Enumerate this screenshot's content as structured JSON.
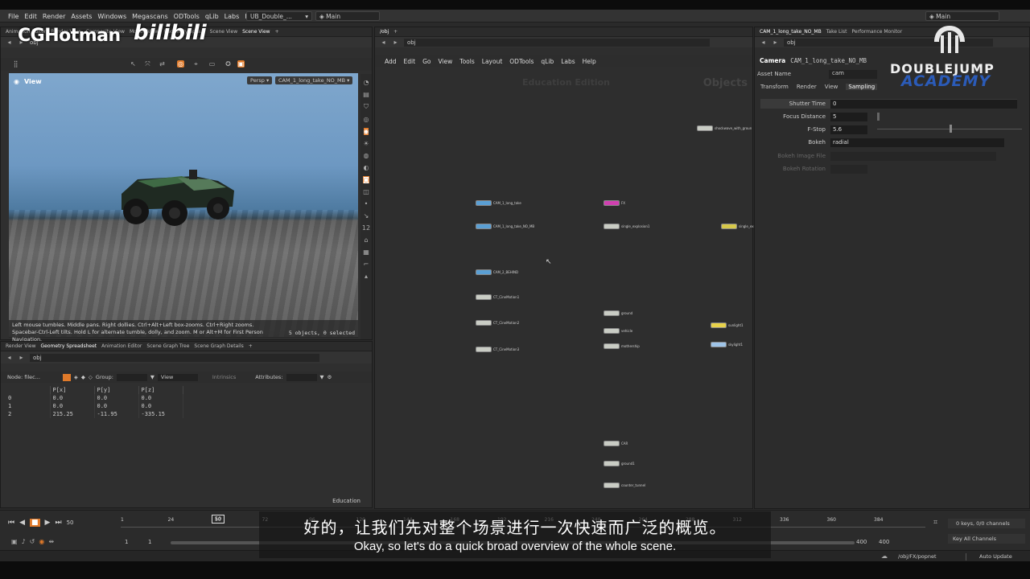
{
  "menubar": {
    "items": [
      "File",
      "Edit",
      "Render",
      "Assets",
      "Windows",
      "Megascans",
      "ODTools",
      "qLib",
      "Labs",
      "Help"
    ],
    "desktop": "UB_Double_...",
    "desktop_right": "Main",
    "desktop_right2": "Main"
  },
  "watermark": {
    "brand": "CGHotman",
    "site": "bilibili",
    "academy_top": "DOUBLEJUMP",
    "academy_bottom": "ACADEMY"
  },
  "left_top": {
    "tabs": [
      "Animation Editor",
      "Render View",
      "Composite View",
      "Motion View",
      "Geometry Spre...",
      "Scene View",
      "Scene View"
    ],
    "path": "obj",
    "viewport_title": "View",
    "persp": "Persp ▾",
    "camera": "CAM_1_long_take_NO_MB ▾",
    "help_text": "Left mouse tumbles. Middle pans. Right dollies. Ctrl+Alt+Left box-zooms. Ctrl+Right zooms. Spacebar-Ctrl-Left tilts. Hold L for alternate tumble, dolly, and zoom. M or Alt+M for First Person Navigation.",
    "selection": "5 objects, 0 selected"
  },
  "left_bottom": {
    "tabs": [
      "Render View",
      "Geometry Spreadsheet",
      "Animation Editor",
      "Scene Graph Tree",
      "Scene Graph Details"
    ],
    "path": "obj",
    "node_label": "Node: filec...",
    "group_label": "Group:",
    "view_label": "View",
    "intrinsics_label": "Intrinsics",
    "attributes_label": "Attributes:",
    "columns": [
      "",
      "P[x]",
      "P[y]",
      "P[z]"
    ],
    "rows": [
      [
        "0",
        "0.0",
        "0.0",
        "0.0"
      ],
      [
        "1",
        "0.0",
        "0.0",
        "0.0"
      ],
      [
        "2",
        "215.25",
        "-11.95",
        "-335.15"
      ]
    ],
    "footer": "Education"
  },
  "network": {
    "tabs": [
      "/obj"
    ],
    "path": "obj",
    "menu": [
      "Add",
      "Edit",
      "Go",
      "View",
      "Tools",
      "Layout",
      "ODTools",
      "qLib",
      "Labs",
      "Help"
    ],
    "watermark": "Education Edition",
    "context": "Objects",
    "nodes": [
      {
        "label": "CAM_1_long_take",
        "color": "#5a9fd4"
      },
      {
        "label": "CAM_1_long_take_NO_MB",
        "color": "#5a9fd4"
      },
      {
        "label": "CAM_2_BEHIND",
        "color": "#5a9fd4"
      },
      {
        "label": "CT_CineMotion1",
        "color": "#c9ccc4"
      },
      {
        "label": "CT_CineMotion2",
        "color": "#c9ccc4"
      },
      {
        "label": "CT_CineMotion3",
        "color": "#c9ccc4"
      },
      {
        "label": "FX",
        "color": "#d040b0"
      },
      {
        "label": "single_explosion1",
        "color": "#c9ccc4"
      },
      {
        "label": "ground",
        "color": "#c9ccc4"
      },
      {
        "label": "vehicle",
        "color": "#c9ccc4"
      },
      {
        "label": "mothership",
        "color": "#c9ccc4"
      },
      {
        "label": "CAR",
        "color": "#c9ccc4"
      },
      {
        "label": "ground1",
        "color": "#c9ccc4"
      },
      {
        "label": "counter_tunnel",
        "color": "#c9ccc4"
      },
      {
        "label": "shockwave_with_groun",
        "color": "#c9ccc4"
      },
      {
        "label": "single_ex",
        "color": "#d6c84a"
      },
      {
        "label": "sunlight1",
        "color": "#e8d24a"
      },
      {
        "label": "skylight1",
        "color": "#9fc4e8"
      }
    ]
  },
  "params": {
    "tabs": [
      "CAM_1_long_take_NO_MB",
      "Take List",
      "Performance Monitor"
    ],
    "path": "obj",
    "node_type": "Camera",
    "node_name": "CAM_1_long_take_NO_MB",
    "asset_name_label": "Asset Name",
    "asset_name_value": "cam",
    "subtabs": [
      "Transform",
      "Render",
      "View",
      "Sampling"
    ],
    "rows": [
      {
        "label": "Shutter Time",
        "value": "0"
      },
      {
        "label": "Focus Distance",
        "value": "5"
      },
      {
        "label": "F-Stop",
        "value": "5.6"
      },
      {
        "label": "Bokeh",
        "value": "radial"
      },
      {
        "label": "Bokeh Image File",
        "value": ""
      },
      {
        "label": "Bokeh Rotation",
        "value": ""
      }
    ]
  },
  "timeline": {
    "frame": "50",
    "ticks": [
      "1",
      "24",
      "50",
      "72",
      "96",
      "120",
      "144",
      "168",
      "192",
      "216",
      "240",
      "264",
      "288",
      "312",
      "336",
      "360",
      "384"
    ],
    "start": "1",
    "start2": "1",
    "end": "400",
    "end2": "400",
    "keys": "0 keys, 0/0 channels",
    "key_all": "Key All Channels",
    "status_path": "/obj/FX/popnet",
    "auto_update": "Auto Update"
  },
  "subtitles": {
    "zh": "好的，让我们先对整个场景进行一次快速而广泛的概览。",
    "en": "Okay, so let's do a quick broad overview of the whole scene."
  },
  "colors": {
    "accent": "#e07a2a",
    "camera_node": "#5a9fd4",
    "selected_tab": "#3b3b3b"
  }
}
